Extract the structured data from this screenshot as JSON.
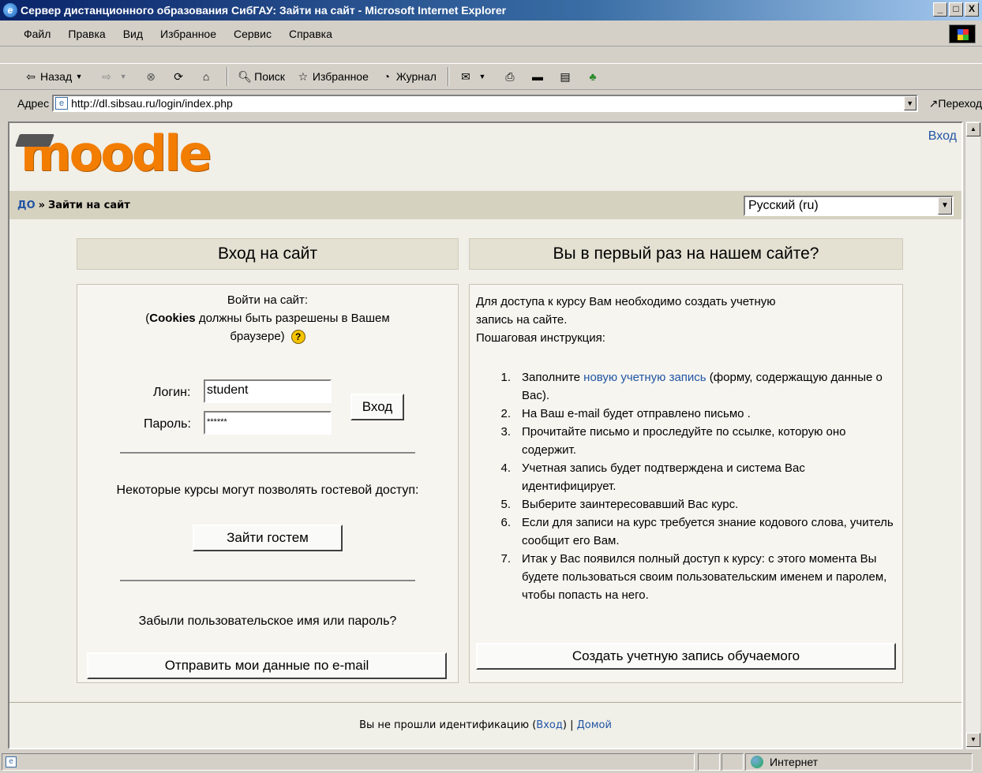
{
  "window": {
    "title": "Сервер дистанционного образования СибГАУ: Зайти на сайт - Microsoft Internet Explorer",
    "min": "_",
    "max": "□",
    "close": "X"
  },
  "menu": [
    "Файл",
    "Правка",
    "Вид",
    "Избранное",
    "Сервис",
    "Справка"
  ],
  "toolbar": {
    "back": "Назад",
    "search": "Поиск",
    "favorites": "Избранное",
    "history": "Журнал"
  },
  "address": {
    "label": "Адрес",
    "url": "http://dl.sibsau.ru/login/index.php",
    "go": "Переход"
  },
  "header": {
    "logo_text": "moodle",
    "login_link": "Вход"
  },
  "nav": {
    "home": "ДО",
    "separator": "»",
    "current": "Зайти на сайт",
    "language": "Русский (ru)"
  },
  "login": {
    "heading": "Вход на сайт",
    "intro_line1": "Войти на сайт:",
    "intro_cookies_bold": "Cookies",
    "intro_cookies_rest": " должны быть разрешены в Вашем",
    "intro_line3": "браузере)",
    "open_paren": "(",
    "username_label": "Логин:",
    "username_value": "student",
    "password_label": "Пароль:",
    "password_value": "******",
    "submit": "Вход",
    "guest_note": "Некоторые курсы могут позволять гостевой доступ:",
    "guest_button": "Зайти гостем",
    "forgot_note": "Забыли пользовательское имя или пароль?",
    "forgot_button": "Отправить мои данные по e-mail"
  },
  "signup": {
    "heading": "Вы в первый раз на нашем сайте?",
    "intro1": "Для доступа к курсу Вам необходимо создать учетную",
    "intro2": "запись на сайте.",
    "intro3": "Пошаговая инструкция:",
    "steps": [
      {
        "num": "1.",
        "pre": "Заполните ",
        "link": "новую учетную запись",
        "post": " (форму, содержащую данные о Вас)."
      },
      {
        "num": "2.",
        "text": "На Ваш e-mail будет отправлено письмо ."
      },
      {
        "num": "3.",
        "text": "Прочитайте письмо и проследуйте по ссылке, которую оно содержит."
      },
      {
        "num": "4.",
        "text": "Учетная запись будет подтверждена и система Вас идентифицирует."
      },
      {
        "num": "5.",
        "text": "Выберите заинтересовавший Вас курс."
      },
      {
        "num": "6.",
        "text": "Если для записи на курс требуется знание кодового слова, учитель сообщит его Вам."
      },
      {
        "num": "7.",
        "text": "Итак у Вас появился полный доступ к курсу: с этого момента Вы будете пользоваться своим пользовательским именем и паролем, чтобы попасть на него."
      }
    ],
    "button": "Создать учетную запись обучаемого"
  },
  "footer": {
    "text": "Вы не прошли идентификацию",
    "login_link": "Вход",
    "divider": "|",
    "home_link": "Домой"
  },
  "status": {
    "zone": "Интернет"
  }
}
